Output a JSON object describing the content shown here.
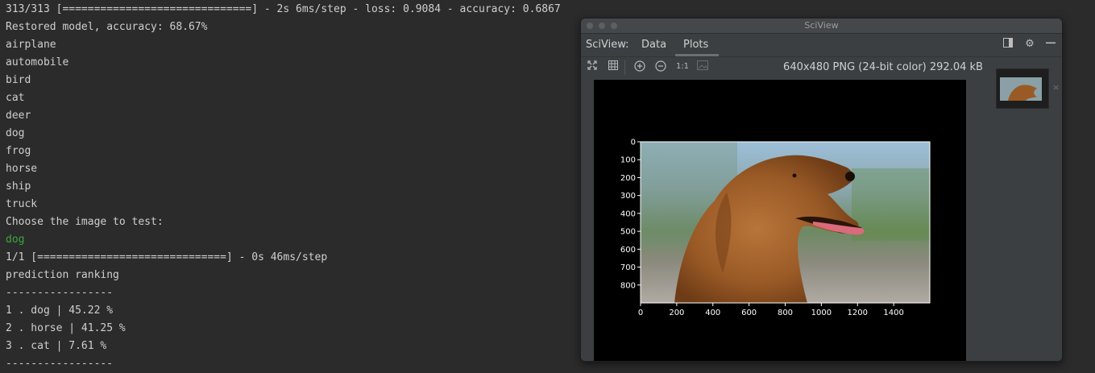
{
  "console": {
    "lines": [
      "313/313 [==============================] - 2s 6ms/step - loss: 0.9084 - accuracy: 0.6867",
      "Restored model, accuracy: 68.67%",
      "airplane",
      "automobile",
      "bird",
      "cat",
      "deer",
      "dog",
      "frog",
      "horse",
      "ship",
      "truck",
      "Choose the image to test:",
      "dog",
      "1/1 [==============================] - 0s 46ms/step",
      "prediction ranking",
      "-----------------",
      "1 . dog | 45.22 %",
      "2 . horse | 41.25 %",
      "3 . cat | 7.61 %",
      "-----------------"
    ],
    "input_color": "#3aa83a"
  },
  "sciview": {
    "window_title": "SciView",
    "label": "SciView:",
    "tabs": [
      "Data",
      "Plots"
    ],
    "active_tab": "Plots",
    "image_info": "640x480 PNG (24-bit color) 292.04 kB",
    "icons": {
      "header": [
        "layout-icon",
        "gear-icon",
        "minimize-icon"
      ],
      "toolbar": [
        "fit-screen-icon",
        "grid-icon",
        "zoom-in-icon",
        "zoom-out-icon",
        "actual-size-icon",
        "image-icon"
      ],
      "actual_size_label": "1:1",
      "thumbnail_close": "×"
    },
    "plot": {
      "x_ticks": [
        "0",
        "200",
        "400",
        "600",
        "800",
        "1000",
        "1200",
        "1400"
      ],
      "y_ticks": [
        "0",
        "100",
        "200",
        "300",
        "400",
        "500",
        "600",
        "700",
        "800"
      ],
      "xlim": [
        0,
        1600
      ],
      "ylim": [
        900,
        0
      ]
    }
  }
}
